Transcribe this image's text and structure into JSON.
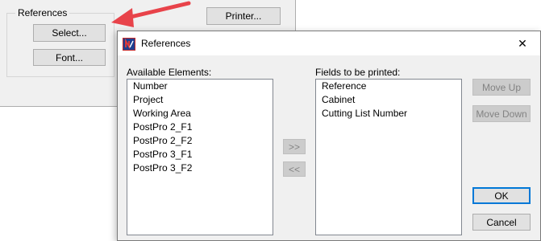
{
  "background_window": {
    "group_title": "References",
    "select_button": "Select...",
    "font_button": "Font...",
    "printer_button": "Printer..."
  },
  "dialog": {
    "title": "References",
    "available_label": "Available Elements:",
    "available_items": [
      "Number",
      "Project",
      "Working Area",
      "PostPro 2_F1",
      "PostPro 2_F2",
      "PostPro 3_F1",
      "PostPro 3_F2"
    ],
    "fields_label": "Fields to be printed:",
    "fields_items": [
      "Reference",
      "Cabinet",
      "Cutting List Number"
    ],
    "add_button": ">>",
    "remove_button": "<<",
    "move_up_button": "Move Up",
    "move_down_button": "Move Down",
    "ok_button": "OK",
    "cancel_button": "Cancel",
    "close_glyph": "✕"
  },
  "colors": {
    "arrow": "#e8434a",
    "accent": "#0078d7",
    "window_bg": "#f0f0f0"
  }
}
